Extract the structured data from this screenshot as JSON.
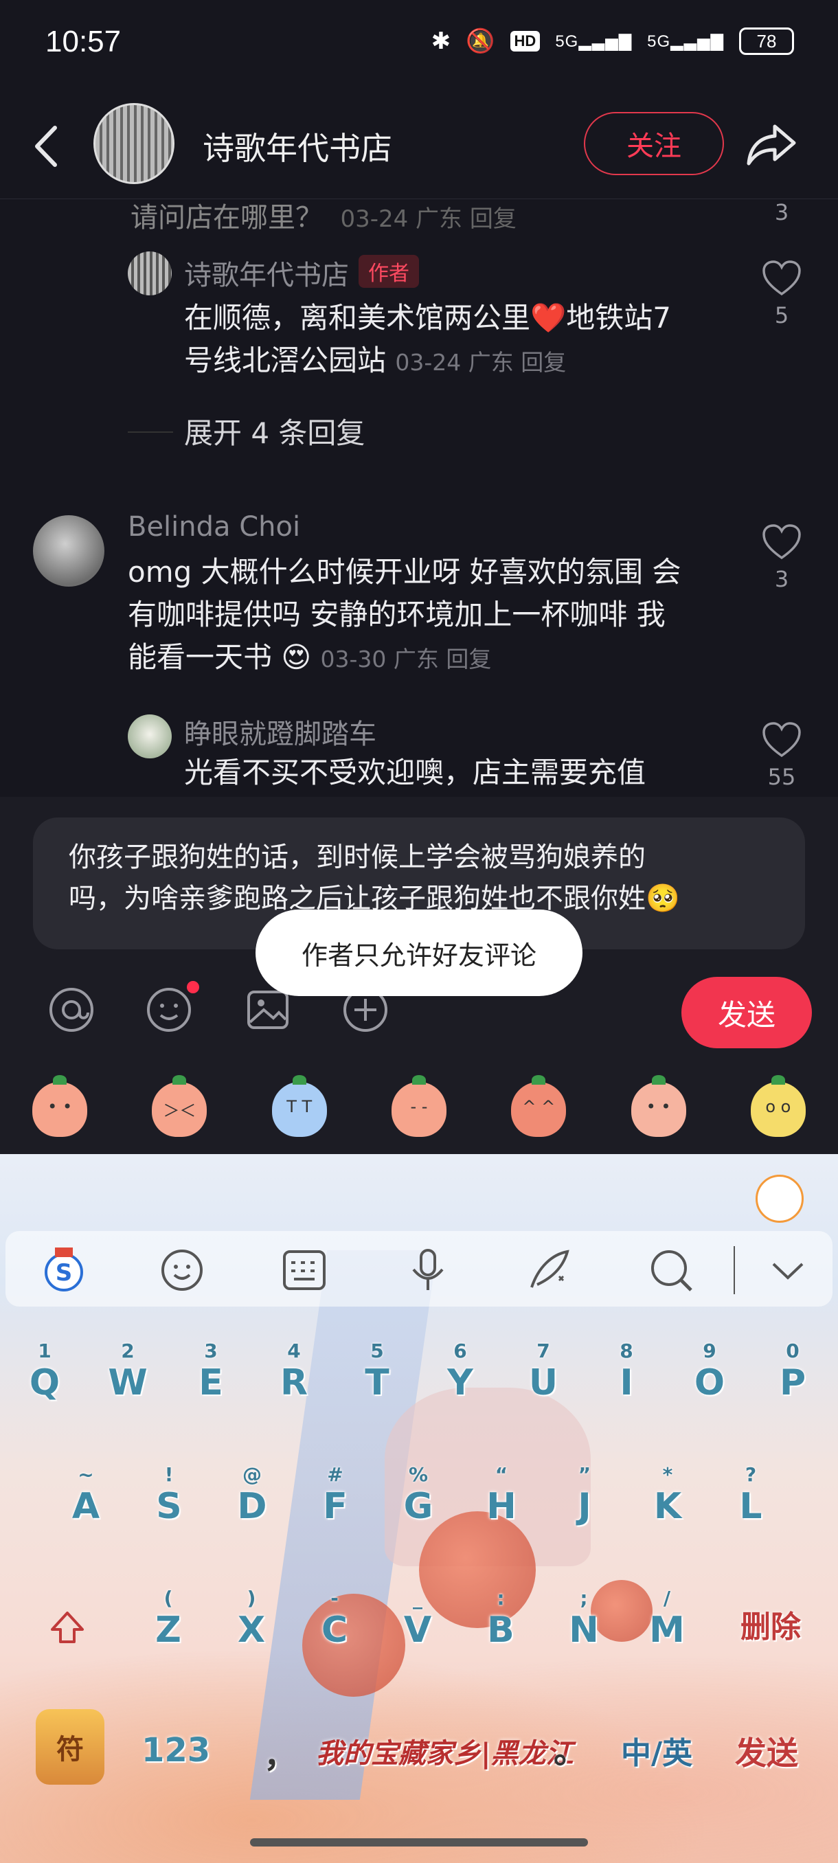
{
  "status_bar": {
    "time": "10:57",
    "hd": "HD",
    "signal1": "5G",
    "signal2": "5G",
    "battery": "78"
  },
  "header": {
    "store_name": "诗歌年代书店",
    "follow_label": "关注"
  },
  "comments": {
    "cut_line_text": "请问店在哪里？",
    "cut_line_meta": "03-24 广东 回复",
    "cut_line_likes": "3",
    "reply1": {
      "name": "诗歌年代书店",
      "tag": "作者",
      "text_line1": "在顺德，离和美术馆两公里❤️地铁站7",
      "text_line2": "号线北滘公园站",
      "meta": "03-24 广东  回复",
      "likes": "5"
    },
    "expand_label": "展开 4 条回复",
    "comment2": {
      "name": "Belinda Choi",
      "text_line1": "omg 大概什么时候开业呀 好喜欢的氛围 会",
      "text_line2": "有咖啡提供吗 安静的环境加上一杯咖啡 我",
      "text_line3": "能看一天书",
      "meta": "03-30 广东  回复",
      "likes": "3"
    },
    "reply2": {
      "name": "睁眼就蹬脚踏车",
      "text_line1": "光看不买不受欢迎噢，店主需要充值",
      "likes": "55"
    }
  },
  "input": {
    "text_line1": "你孩子跟狗姓的话，到时候上学会被骂狗娘养的",
    "text_line2": "吗，为啥亲爹跑路之后让孩子跟狗姓也不跟你姓",
    "toast": "作者只允许好友评论",
    "send_label": "发送"
  },
  "keyboard": {
    "row1": [
      {
        "hint": "1",
        "key": "Q"
      },
      {
        "hint": "2",
        "key": "W"
      },
      {
        "hint": "3",
        "key": "E"
      },
      {
        "hint": "4",
        "key": "R"
      },
      {
        "hint": "5",
        "key": "T"
      },
      {
        "hint": "6",
        "key": "Y"
      },
      {
        "hint": "7",
        "key": "U"
      },
      {
        "hint": "8",
        "key": "I"
      },
      {
        "hint": "9",
        "key": "O"
      },
      {
        "hint": "0",
        "key": "P"
      }
    ],
    "row2": [
      {
        "hint": "~",
        "key": "A"
      },
      {
        "hint": "!",
        "key": "S"
      },
      {
        "hint": "@",
        "key": "D"
      },
      {
        "hint": "#",
        "key": "F"
      },
      {
        "hint": "%",
        "key": "G"
      },
      {
        "hint": "“",
        "key": "H"
      },
      {
        "hint": "”",
        "key": "J"
      },
      {
        "hint": "*",
        "key": "K"
      },
      {
        "hint": "?",
        "key": "L"
      }
    ],
    "row3": [
      {
        "hint": "(",
        "key": "Z"
      },
      {
        "hint": ")",
        "key": "X"
      },
      {
        "hint": "-",
        "key": "C"
      },
      {
        "hint": "_",
        "key": "V"
      },
      {
        "hint": ":",
        "key": "B"
      },
      {
        "hint": ";",
        "key": "N"
      },
      {
        "hint": "/",
        "key": "M"
      }
    ],
    "delete_label": "删除",
    "symbol_label": "符",
    "num_label": "123",
    "comma": "，",
    "space_label": "我的宝藏家乡|黑龙江",
    "period": "。",
    "lang_label": "中/英",
    "send_label": "发送"
  }
}
